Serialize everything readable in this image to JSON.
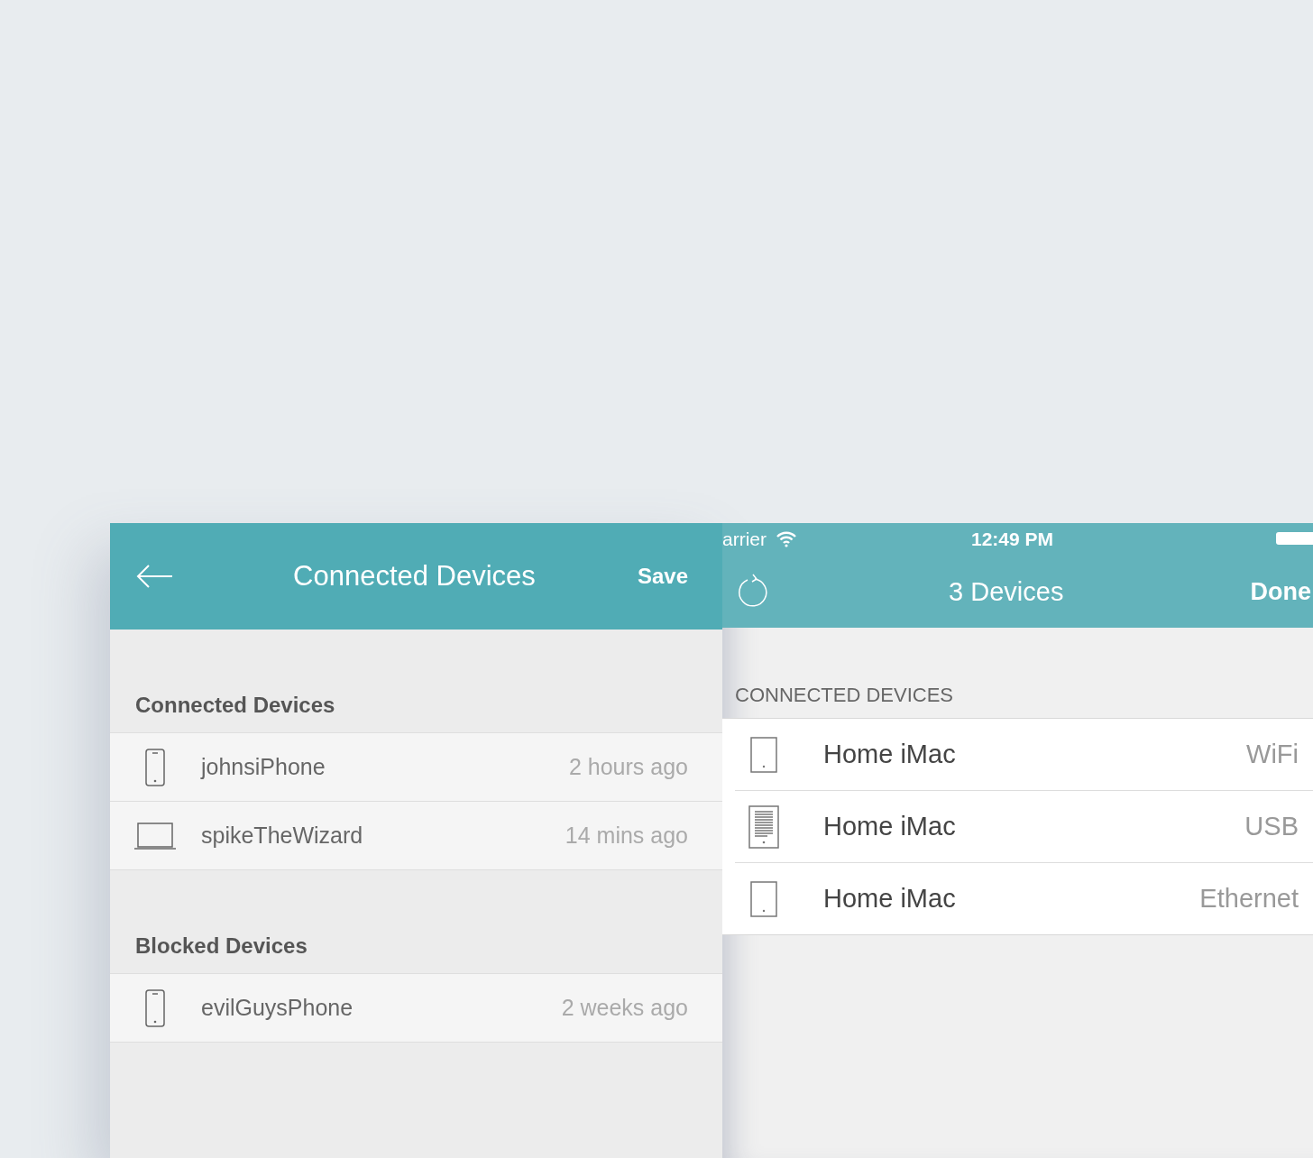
{
  "left_screen": {
    "title": "Connected Devices",
    "save_button": "Save",
    "sections": [
      {
        "title": "Connected Devices",
        "devices": [
          {
            "kind": "phone",
            "name": "johnsiPhone",
            "last_seen": "2 hours ago"
          },
          {
            "kind": "laptop",
            "name": "spikeTheWizard",
            "last_seen": "14 mins ago"
          }
        ]
      },
      {
        "title": "Blocked Devices",
        "devices": [
          {
            "kind": "phone",
            "name": "evilGuysPhone",
            "last_seen": "2 weeks ago"
          }
        ]
      }
    ]
  },
  "right_screen": {
    "status_bar": {
      "carrier": "arrier",
      "time": "12:49 PM"
    },
    "title": "3 Devices",
    "done_button": "Done",
    "section_title": "CONNECTED DEVICES",
    "devices": [
      {
        "kind": "tablet",
        "name": "Home iMac",
        "connection": "WiFi"
      },
      {
        "kind": "ereader",
        "name": "Home iMac",
        "connection": "USB"
      },
      {
        "kind": "tablet",
        "name": "Home iMac",
        "connection": "Ethernet"
      }
    ]
  }
}
